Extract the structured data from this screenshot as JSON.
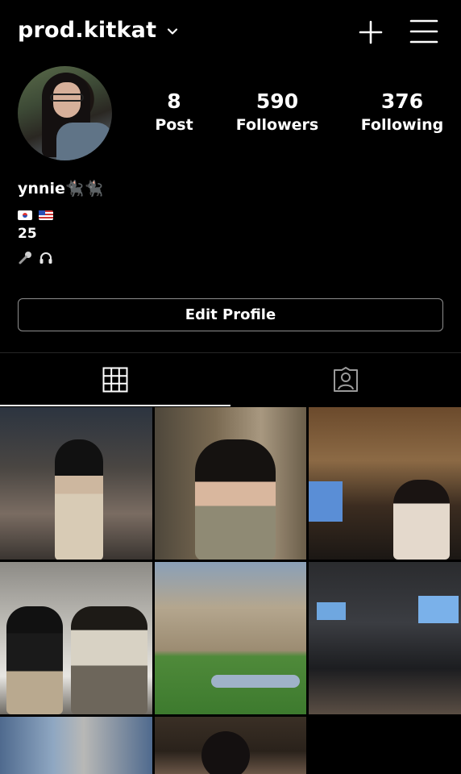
{
  "header": {
    "username": "prod.kitkat",
    "icons": [
      "chevron-down-icon",
      "plus-icon",
      "hamburger-menu-icon"
    ]
  },
  "profile": {
    "stats": [
      {
        "value": "8",
        "label": "Post"
      },
      {
        "value": "590",
        "label": "Followers"
      },
      {
        "value": "376",
        "label": "Following"
      }
    ]
  },
  "bio": {
    "name": "ynnie🐈‍⬛🐈‍⬛",
    "flags": [
      "south-korea-flag-icon",
      "united-states-flag-icon"
    ],
    "age": "25",
    "icons": [
      "microphone-icon",
      "headphones-icon"
    ]
  },
  "actions": {
    "edit_profile": "Edit Profile"
  },
  "tabs": [
    {
      "icon": "grid-icon",
      "active": true
    },
    {
      "icon": "tagged-person-icon",
      "active": false
    }
  ],
  "colors": {
    "background": "#000000",
    "text": "#ffffff",
    "button_border": "#8e8e8e",
    "divider": "#262626"
  }
}
